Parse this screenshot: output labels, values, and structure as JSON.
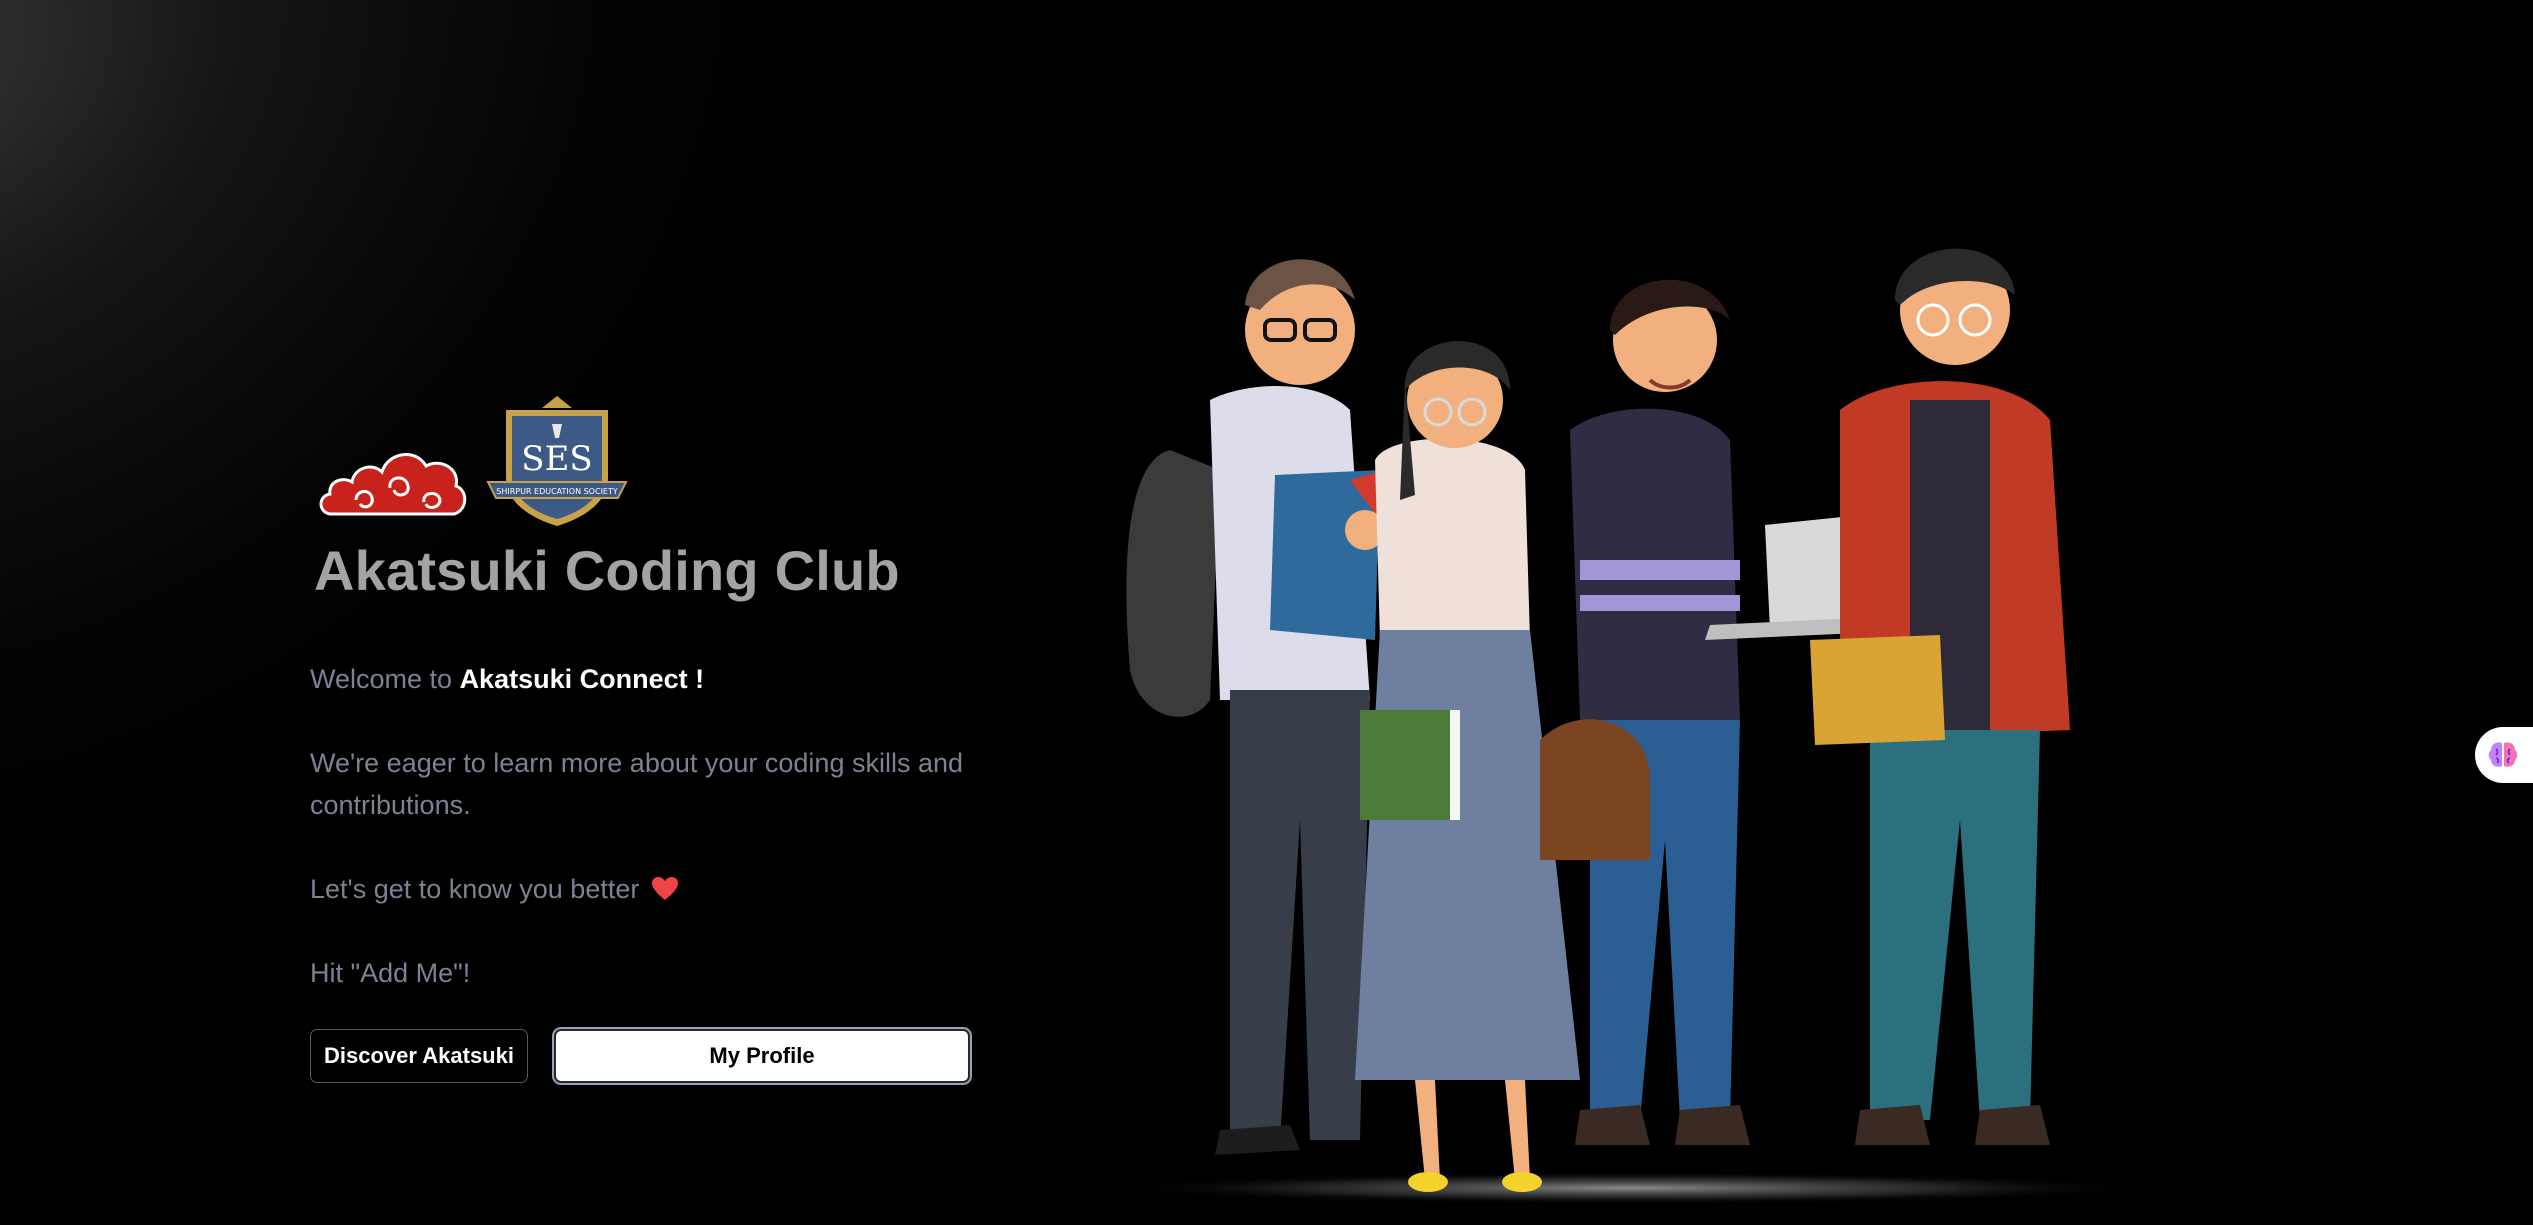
{
  "brand": {
    "logo_cloud": "akatsuki-cloud-logo",
    "logo_ses": "ses-crest-logo",
    "ses_letters": "SES",
    "ses_ribbon": "SHIRPUR EDUCATION SOCIETY"
  },
  "hero": {
    "title": "Akatsuki Coding Club",
    "welcome_prefix": "Welcome to ",
    "welcome_strong": "Akatsuki Connect !",
    "eager": "We're eager to learn more about your coding skills and contributions.",
    "know": "Let's get to know you better",
    "know_icon": "heart-icon",
    "hit": "Hit \"Add Me\"!"
  },
  "buttons": {
    "discover": "Discover Akatsuki",
    "profile": "My Profile"
  },
  "illustration": {
    "name": "students-group-illustration"
  },
  "side_widget": {
    "icon": "brain-icon"
  },
  "colors": {
    "background": "#000000",
    "title": "#a3a3a3",
    "body_text": "#7b8294",
    "accent_red": "#c8221c",
    "heart": "#ef4444"
  }
}
